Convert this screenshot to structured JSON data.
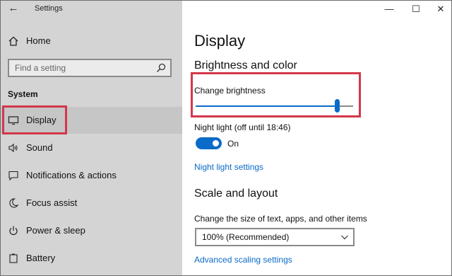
{
  "window": {
    "title": "Settings"
  },
  "sidebar": {
    "home_label": "Home",
    "search_placeholder": "Find a setting",
    "section_title": "System",
    "items": [
      {
        "label": "Display",
        "icon": "monitor-icon",
        "active": true
      },
      {
        "label": "Sound",
        "icon": "speaker-icon"
      },
      {
        "label": "Notifications & actions",
        "icon": "notification-icon"
      },
      {
        "label": "Focus assist",
        "icon": "moon-icon"
      },
      {
        "label": "Power & sleep",
        "icon": "power-icon"
      },
      {
        "label": "Battery",
        "icon": "battery-icon"
      }
    ]
  },
  "main": {
    "title": "Display",
    "brightness_heading": "Brightness and color",
    "brightness_label": "Change brightness",
    "brightness_level": 0.9,
    "night_light_label": "Night light (off until 18:46)",
    "night_light_state": "On",
    "night_light_link": "Night light settings",
    "scale_heading": "Scale and layout",
    "scale_label": "Change the size of text, apps, and other items",
    "scale_value": "100% (Recommended)",
    "advanced_link": "Advanced scaling settings"
  },
  "colors": {
    "accent": "#0b6bc8",
    "highlight_box": "#d3374a",
    "sidebar_bg": "#d4d4d4"
  }
}
